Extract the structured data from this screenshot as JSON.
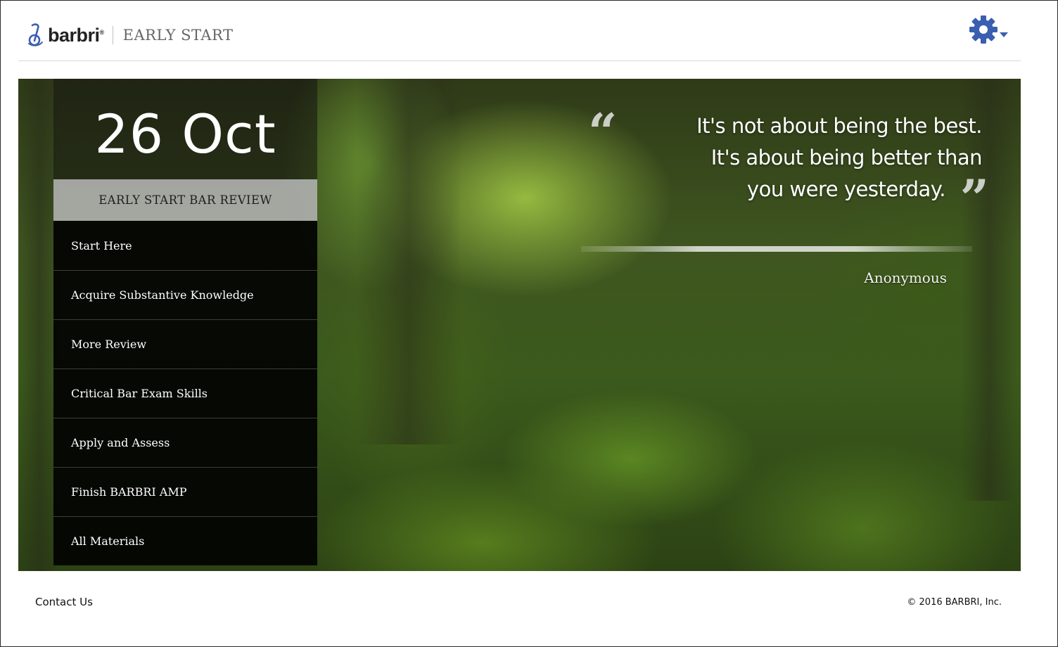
{
  "header": {
    "logo_word": "barbri",
    "logo_reg": "®",
    "product": "EARLY START",
    "settings_icon": "gear-icon",
    "accent_color": "#3a5fb0"
  },
  "hero": {
    "date": "26 Oct",
    "menu_title": "EARLY START BAR REVIEW",
    "menu_items": [
      "Start Here",
      "Acquire Substantive Knowledge",
      "More Review",
      "Critical Bar Exam Skills",
      "Apply and Assess",
      "Finish BARBRI AMP",
      "All Materials"
    ],
    "quote": {
      "line1": "It's not about being the best.",
      "line2": "It's about being better than",
      "line3": "you were yesterday.",
      "open_mark": "“",
      "close_mark": "”",
      "attribution": "Anonymous"
    }
  },
  "footer": {
    "contact": "Contact Us",
    "copyright": "© 2016 BARBRI, Inc."
  }
}
